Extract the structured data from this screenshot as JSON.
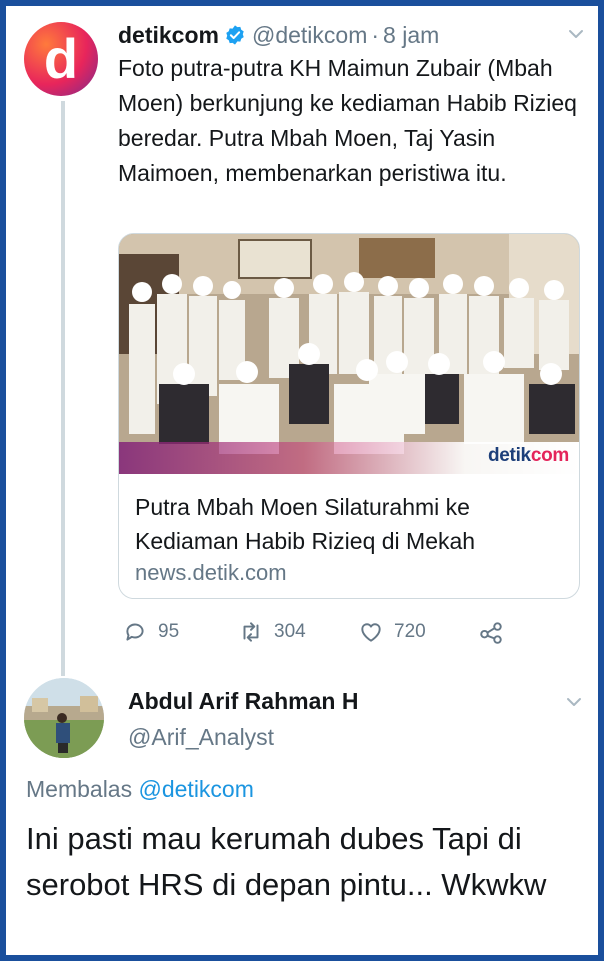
{
  "tweet": {
    "name": "detikcom",
    "handle": "@detikcom",
    "separator": "·",
    "time": "8 jam",
    "text": "Foto putra-putra KH Maimun Zubair (Mbah Moen) berkunjung ke kediaman Habib Rizieq beredar. Putra Mbah Moen, Taj Yasin Maimoen, membenarkan peristiwa itu.",
    "avatar_letter": "d",
    "card": {
      "image_logo_prefix": "detik",
      "image_logo_suffix": "com",
      "title": "Putra Mbah Moen Silaturahmi ke Kediaman Habib Rizieq di Mekah",
      "domain": "news.detik.com"
    },
    "actions": {
      "replies": "95",
      "retweets": "304",
      "likes": "720"
    }
  },
  "reply": {
    "name": "Abdul Arif Rahman H",
    "handle": "@Arif_Analyst",
    "replying_prefix": "Membalas",
    "replying_to": "@detikcom",
    "text": "Ini pasti mau kerumah dubes Tapi di serobot HRS di depan pintu... Wkwkw"
  },
  "colors": {
    "border_frame": "#1a4f9c",
    "link_blue": "#1b95e0",
    "muted_gray": "#657786",
    "verified_blue": "#1da1f2"
  },
  "icons": [
    "verified-icon",
    "chevron-down-icon",
    "reply-icon",
    "retweet-icon",
    "like-icon",
    "share-icon"
  ]
}
